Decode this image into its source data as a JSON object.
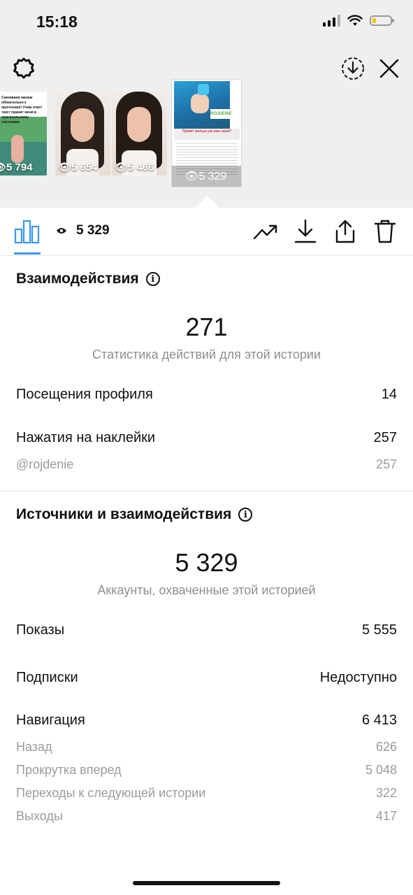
{
  "status_bar": {
    "time": "15:18"
  },
  "thumbnails": [
    {
      "views": "5 794",
      "overlay_text": "Скачиваем малам обязательно к прочтению! Учим ответ текст принят меня в оригинальному состоянии"
    },
    {
      "views": "5 654"
    },
    {
      "views": "5 466"
    },
    {
      "views": "5 329",
      "caption": "Привет малыш как вам наши?",
      "brand": "ROJDENIE"
    }
  ],
  "toolbar": {
    "views": "5 329"
  },
  "interactions": {
    "title": "Взаимодействия",
    "total": "271",
    "subtitle": "Статистика действий для этой истории",
    "rows": [
      {
        "label": "Посещения профиля",
        "value": "14"
      },
      {
        "label": "Нажатия на наклейки",
        "value": "257"
      }
    ],
    "sticker_rows": [
      {
        "label": "@rojdenie",
        "value": "257"
      }
    ]
  },
  "discovery": {
    "title": "Источники и взаимодействия",
    "total": "5 329",
    "subtitle": "Аккаунты, охваченные этой историей",
    "rows": [
      {
        "label": "Показы",
        "value": "5 555"
      },
      {
        "label": "Подписки",
        "value": "Недоступно"
      },
      {
        "label": "Навигация",
        "value": "6 413"
      }
    ],
    "navigation_rows": [
      {
        "label": "Назад",
        "value": "626"
      },
      {
        "label": "Прокрутка вперед",
        "value": "5 048"
      },
      {
        "label": "Переходы к следующей истории",
        "value": "322"
      },
      {
        "label": "Выходы",
        "value": "417"
      }
    ]
  },
  "colors": {
    "accent": "#3897f0",
    "background_top": "#efefef",
    "muted_text": "#8e8e8e"
  }
}
